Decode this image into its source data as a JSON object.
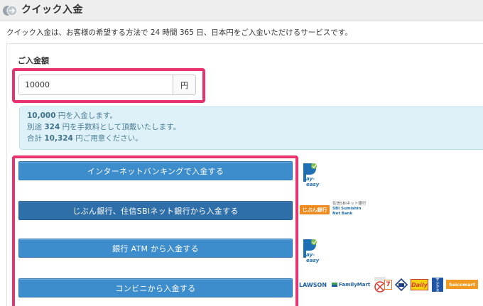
{
  "header": {
    "title": "クイック入金",
    "icon": "deposit-arrows-icon"
  },
  "description": "クイック入金は、お客様の希望する方法で 24 時間 365 日、日本円をご入金いただけるサービスです。",
  "amount": {
    "label": "ご入金額",
    "value": "10000",
    "unit": "円"
  },
  "info": {
    "line1_amount": "10,000",
    "line1_rest": " 円を入金します。",
    "line2_prefix": "別途 ",
    "line2_fee": "324",
    "line2_rest": " 円を手数料として頂戴いたします。",
    "line3_prefix": "合計 ",
    "line3_total": "10,324",
    "line3_rest": " 円ご用意ください。"
  },
  "buttons": {
    "internet_banking": "インターネットバンキングで入金する",
    "jibun_sbi": "じぶん銀行、住信SBIネット銀行から入金する",
    "atm": "銀行 ATM から入金する",
    "convenience": "コンビニから入金する"
  },
  "logos": {
    "payeasy_text": "ay-easy",
    "jibun": "じぶん銀行",
    "sbi_top": "住信SBIネット銀行",
    "sbi_bottom": "SBI Sumishin Net Bank",
    "lawson": "LAWSON",
    "familymart": "FamilyMart",
    "ministop": "MINI STOP",
    "seven": "7",
    "circlek": "Circle K",
    "daily": "Daily",
    "seicomart": "Seicomart",
    "sunkus": "サンクス"
  },
  "colors": {
    "accent_button": "#3d8ccc",
    "highlight": "#e8336e",
    "info_bg": "#def1f8"
  }
}
